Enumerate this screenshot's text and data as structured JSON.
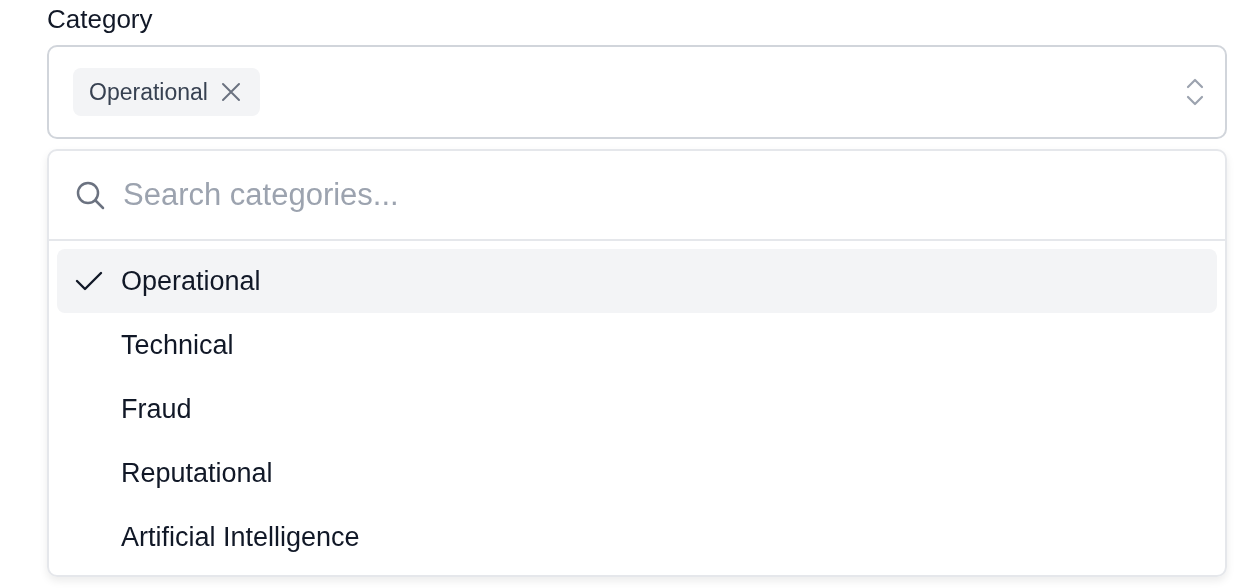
{
  "field": {
    "label": "Category",
    "chips": [
      {
        "label": "Operational"
      }
    ]
  },
  "dropdown": {
    "search": {
      "placeholder": "Search categories..."
    },
    "options": [
      {
        "label": "Operational",
        "selected": true
      },
      {
        "label": "Technical",
        "selected": false
      },
      {
        "label": "Fraud",
        "selected": false
      },
      {
        "label": "Reputational",
        "selected": false
      },
      {
        "label": "Artificial Intelligence",
        "selected": false
      }
    ]
  }
}
